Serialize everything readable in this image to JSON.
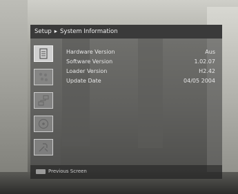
{
  "header": {
    "menu": "Setup",
    "separator_glyph": "▸",
    "title": "System Information"
  },
  "sidebar": {
    "icons": [
      {
        "name": "system-information-icon",
        "active": true
      },
      {
        "name": "installation-icon",
        "active": false
      },
      {
        "name": "network-icon",
        "active": false
      },
      {
        "name": "disc-icon",
        "active": false
      },
      {
        "name": "tools-icon",
        "active": false
      }
    ]
  },
  "info": {
    "rows": [
      {
        "label": "Hardware Version",
        "value": "Aus"
      },
      {
        "label": "Software Version",
        "value": "1.02.07"
      },
      {
        "label": "Loader Version",
        "value": "H2.42"
      },
      {
        "label": "Update Date",
        "value": "04/05 2004"
      }
    ]
  },
  "footer": {
    "key_label": "",
    "text": "Previous Screen"
  }
}
